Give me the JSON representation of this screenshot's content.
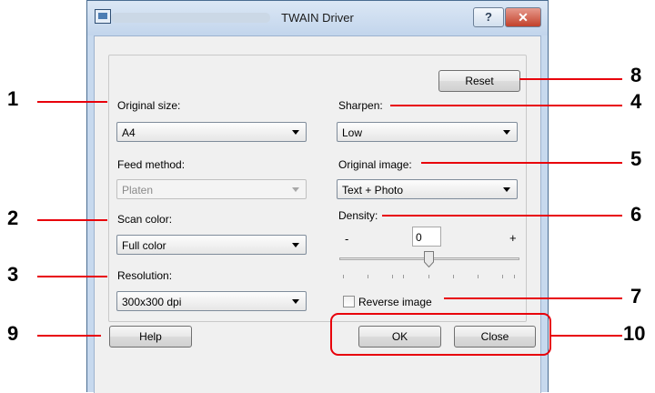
{
  "window": {
    "title": "TWAIN Driver",
    "help_glyph": "?",
    "close_glyph": "✕",
    "icons": [
      "app-icon",
      "help-icon",
      "close-icon"
    ]
  },
  "settings": {
    "original_size": {
      "label": "Original size:",
      "value": "A4"
    },
    "feed_method": {
      "label": "Feed method:",
      "value": "Platen",
      "disabled": true
    },
    "scan_color": {
      "label": "Scan color:",
      "value": "Full color"
    },
    "resolution": {
      "label": "Resolution:",
      "value": "300x300 dpi"
    },
    "sharpen": {
      "label": "Sharpen:",
      "value": "Low"
    },
    "original_image": {
      "label": "Original image:",
      "value": "Text + Photo"
    },
    "density": {
      "label": "Density:",
      "value": "0",
      "minus": "-",
      "plus": "+"
    },
    "reverse_image": {
      "label": "Reverse image",
      "checked": false
    }
  },
  "buttons": {
    "reset": "Reset",
    "help": "Help",
    "ok": "OK",
    "close": "Close"
  },
  "callouts": [
    "1",
    "2",
    "3",
    "4",
    "5",
    "6",
    "7",
    "8",
    "9",
    "10"
  ],
  "colors": {
    "callout_line": "#e8000b",
    "title_bar": "#c7d9ee"
  }
}
